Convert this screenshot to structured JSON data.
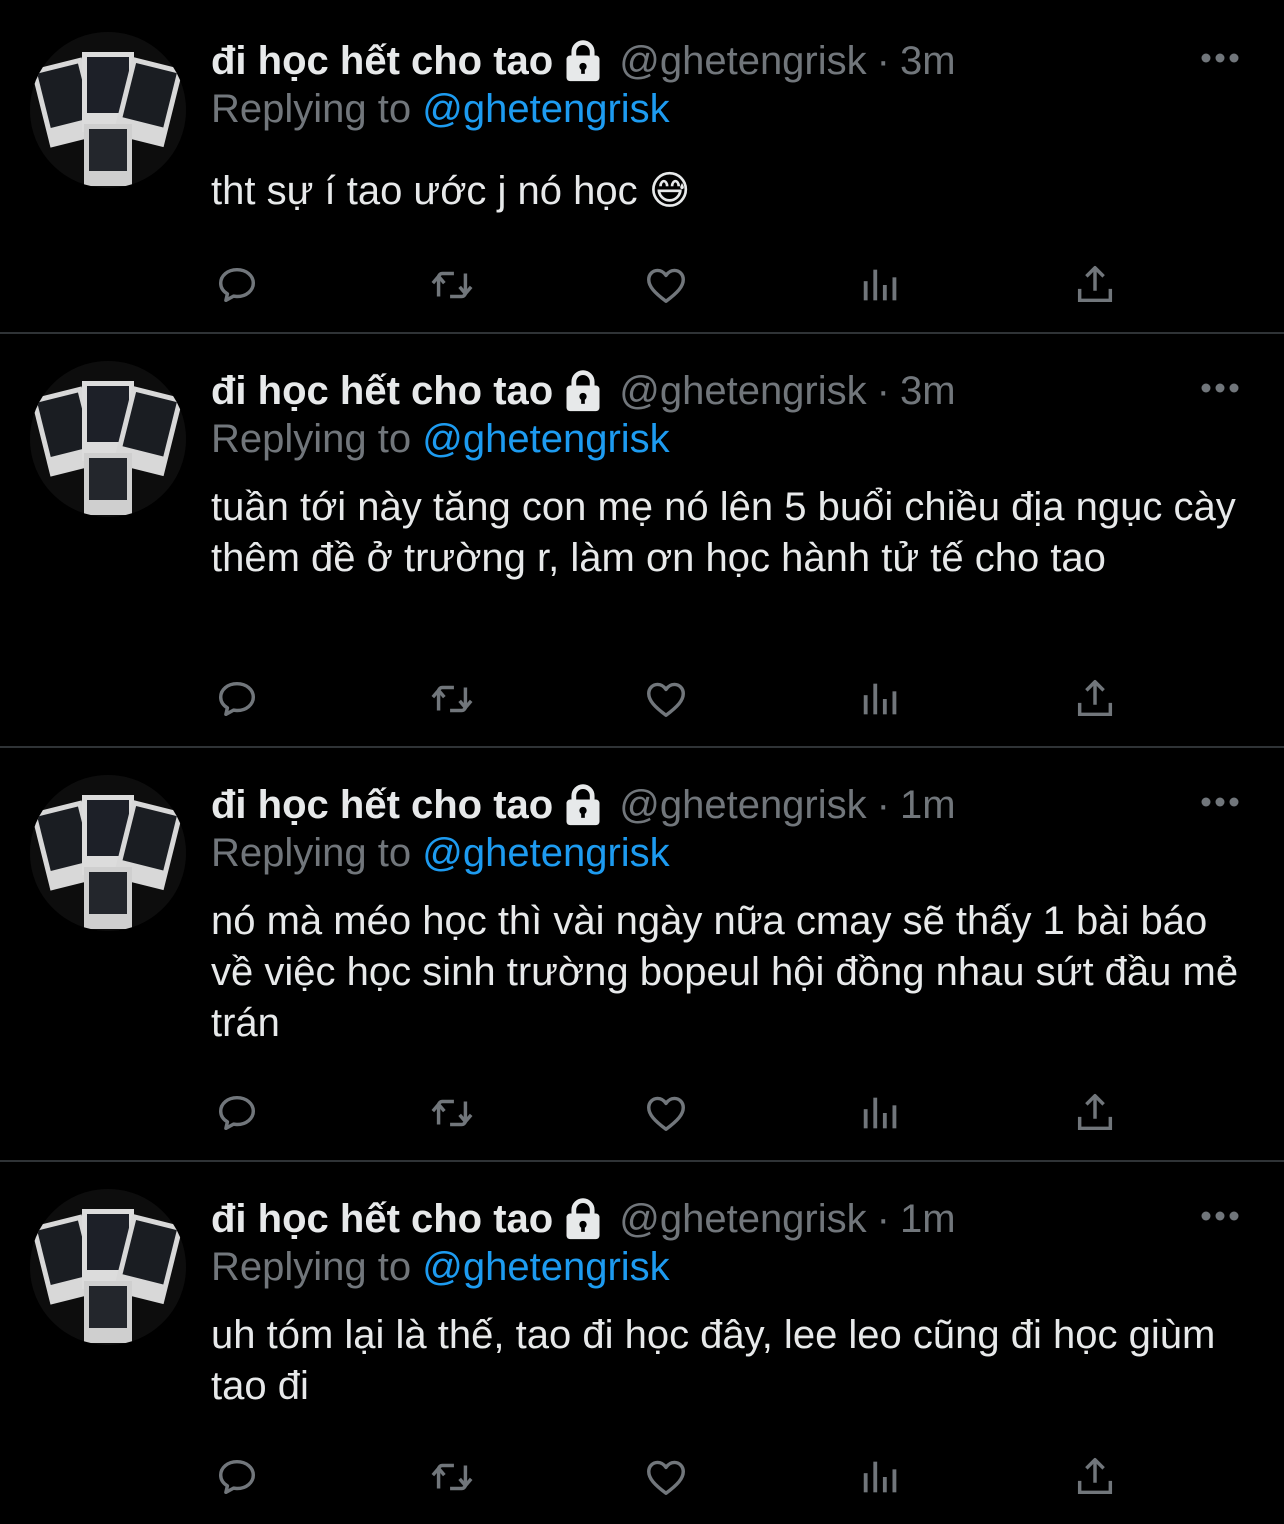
{
  "tweets": [
    {
      "display_name": "đi học hết cho tao",
      "handle": "@ghetengrisk",
      "separator": "·",
      "time": "3m",
      "replying_prefix": "Replying to",
      "replying_to": "@ghetengrisk",
      "text": "tht sự í tao ước j nó học 😅"
    },
    {
      "display_name": "đi học hết cho tao",
      "handle": "@ghetengrisk",
      "separator": "·",
      "time": "3m",
      "replying_prefix": "Replying to",
      "replying_to": "@ghetengrisk",
      "text": "tuần tới này tăng con mẹ nó lên 5 buổi chiều địa ngục cày thêm đề ở trường r, làm ơn học hành tử tế cho tao"
    },
    {
      "display_name": "đi học hết cho tao",
      "handle": "@ghetengrisk",
      "separator": "·",
      "time": "1m",
      "replying_prefix": "Replying to",
      "replying_to": "@ghetengrisk",
      "text": "nó mà méo học thì vài ngày nữa cmay sẽ thấy 1 bài báo về việc học sinh trường bopeul hội đồng nhau sứt đầu mẻ trán"
    },
    {
      "display_name": "đi học hết cho tao",
      "handle": "@ghetengrisk",
      "separator": "·",
      "time": "1m",
      "replying_prefix": "Replying to",
      "replying_to": "@ghetengrisk",
      "text": "uh tóm lại là thế, tao đi học đây, lee leo cũng đi học giùm tao đi"
    }
  ],
  "icons": {
    "lock": "lock-icon",
    "more": "more-icon",
    "reply": "reply-icon",
    "retweet": "retweet-icon",
    "like": "heart-icon",
    "views": "views-icon",
    "share": "share-icon"
  },
  "colors": {
    "background": "#000000",
    "text_primary": "#e7e9ea",
    "text_secondary": "#71767b",
    "mention": "#1d9bf0",
    "divider": "#2f3336"
  }
}
